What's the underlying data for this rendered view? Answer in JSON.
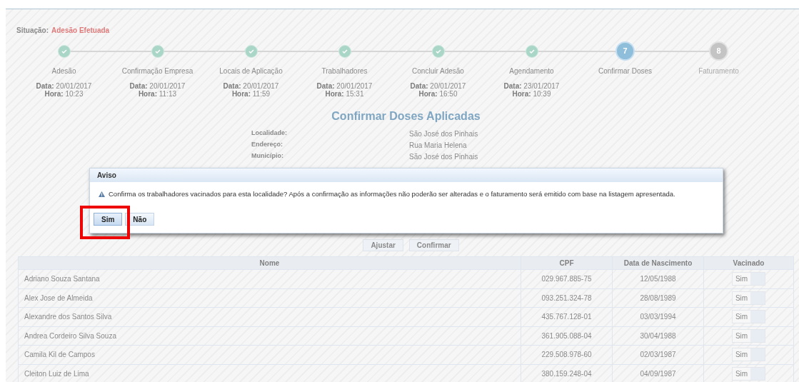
{
  "status": {
    "label": "Situação:",
    "value": "Adesão Efetuada"
  },
  "steps": [
    {
      "label": "Adesão",
      "kind": "done",
      "date_label": "Data:",
      "date": "20/01/2017",
      "time_label": "Hora:",
      "time": "10:23"
    },
    {
      "label": "Confirmação Empresa",
      "kind": "done",
      "date_label": "Data:",
      "date": "20/01/2017",
      "time_label": "Hora:",
      "time": "11:13"
    },
    {
      "label": "Locais de Aplicação",
      "kind": "done",
      "date_label": "Data:",
      "date": "20/01/2017",
      "time_label": "Hora:",
      "time": "11:59"
    },
    {
      "label": "Trabalhadores",
      "kind": "done",
      "date_label": "Data:",
      "date": "20/01/2017",
      "time_label": "Hora:",
      "time": "15:31"
    },
    {
      "label": "Concluir Adesão",
      "kind": "done",
      "date_label": "Data:",
      "date": "20/01/2017",
      "time_label": "Hora:",
      "time": "16:50"
    },
    {
      "label": "Agendamento",
      "kind": "done",
      "date_label": "Data:",
      "date": "23/01/2017",
      "time_label": "Hora:",
      "time": "10:39"
    },
    {
      "label": "Confirmar Doses",
      "kind": "current",
      "number": "7"
    },
    {
      "label": "Faturamento",
      "kind": "pending",
      "number": "8"
    }
  ],
  "section_title": "Confirmar Doses Aplicadas",
  "info": [
    {
      "label": "Localidade:",
      "value": "São José dos Pinhais"
    },
    {
      "label": "Endereço:",
      "value": "Rua Maria Helena"
    },
    {
      "label": "Município:",
      "value": "São José dos Pinhais"
    }
  ],
  "actions": [
    "Ajustar",
    "Confirmar"
  ],
  "table": {
    "columns": [
      "Nome",
      "CPF",
      "Data de Nascimento",
      "Vacinado"
    ],
    "rows": [
      [
        "Adriano Souza Santana",
        "029.967.885-75",
        "12/05/1988",
        "Sim"
      ],
      [
        "Alex Jose de Almeida",
        "093.251.324-78",
        "28/08/1989",
        "Sim"
      ],
      [
        "Alexandre dos Santos Silva",
        "435.767.128-01",
        "03/03/1994",
        "Sim"
      ],
      [
        "Andrea Cordeiro Silva Souza",
        "361.905.088-04",
        "30/04/1988",
        "Sim"
      ],
      [
        "Camila Kil de Campos",
        "229.508.978-60",
        "02/03/1987",
        "Sim"
      ],
      [
        "Cleiton Luiz de Lima",
        "380.159.248-04",
        "04/09/1987",
        "Sim"
      ]
    ]
  },
  "dialog": {
    "title": "Aviso",
    "message": "Confirma os trabalhadores vacinados para esta localidade? Após a confirmação as informações não poderão ser alteradas e o faturamento será emitido com base na listagem apresentada.",
    "buttons": [
      {
        "label": "Sim",
        "highlighted": true
      },
      {
        "label": "Não",
        "highlighted": false
      }
    ]
  }
}
